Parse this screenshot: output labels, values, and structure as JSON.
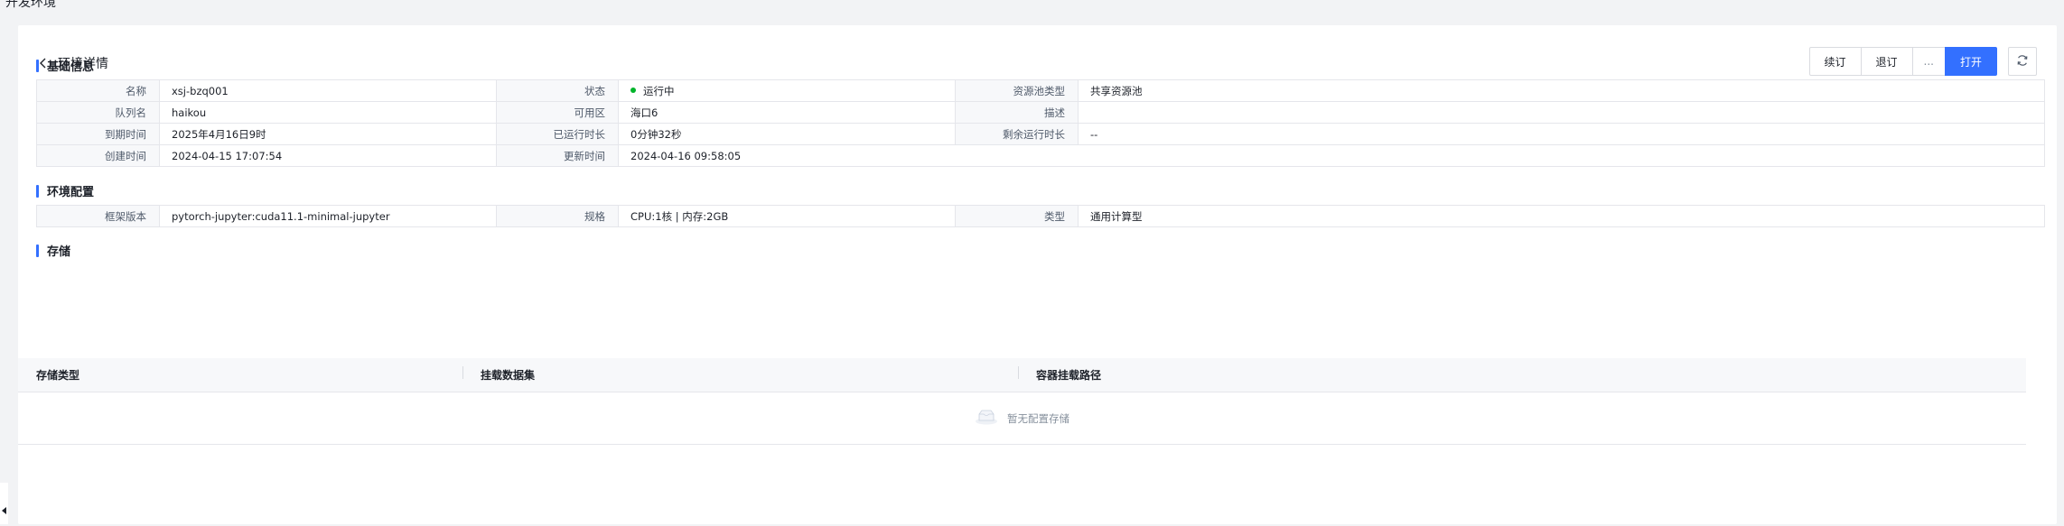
{
  "page": {
    "top_title": "开发环境"
  },
  "header": {
    "title": "环境详情",
    "actions": {
      "renew": "续订",
      "unsubscribe": "退订",
      "more": "...",
      "open": "打开"
    }
  },
  "basic_info": {
    "title": "基础信息",
    "rows": [
      [
        {
          "label": "名称",
          "value": "xsj-bzq001"
        },
        {
          "label": "状态",
          "value": "运行中"
        },
        {
          "label": "资源池类型",
          "value": "共享资源池"
        }
      ],
      [
        {
          "label": "队列名",
          "value": "haikou"
        },
        {
          "label": "可用区",
          "value": "海口6"
        },
        {
          "label": "描述",
          "value": ""
        }
      ],
      [
        {
          "label": "到期时间",
          "value": "2025年4月16日9时"
        },
        {
          "label": "已运行时长",
          "value": "0分钟32秒"
        },
        {
          "label": "剩余运行时长",
          "value": "--"
        }
      ],
      [
        {
          "label": "创建时间",
          "value": "2024-04-15 17:07:54"
        },
        {
          "label": "更新时间",
          "value": "2024-04-16 09:58:05"
        }
      ]
    ],
    "status_color": "#00b42a"
  },
  "env_config": {
    "title": "环境配置",
    "rows": [
      [
        {
          "label": "框架版本",
          "value": "pytorch-jupyter:cuda11.1-minimal-jupyter"
        },
        {
          "label": "规格",
          "value": "CPU:1核 | 内存:2GB"
        },
        {
          "label": "类型",
          "value": "通用计算型"
        }
      ]
    ]
  },
  "storage": {
    "title": "存储",
    "columns": [
      "存储类型",
      "挂载数据集",
      "容器挂载路径"
    ],
    "empty_text": "暂无配置存储"
  },
  "icons": {
    "back": "chevron-left-icon",
    "refresh": "refresh-icon",
    "empty": "empty-box-icon",
    "collapse": "caret-left-icon"
  },
  "colors": {
    "primary": "#3370ff",
    "accent_bar": "#3370ff",
    "background": "#f2f3f5"
  }
}
